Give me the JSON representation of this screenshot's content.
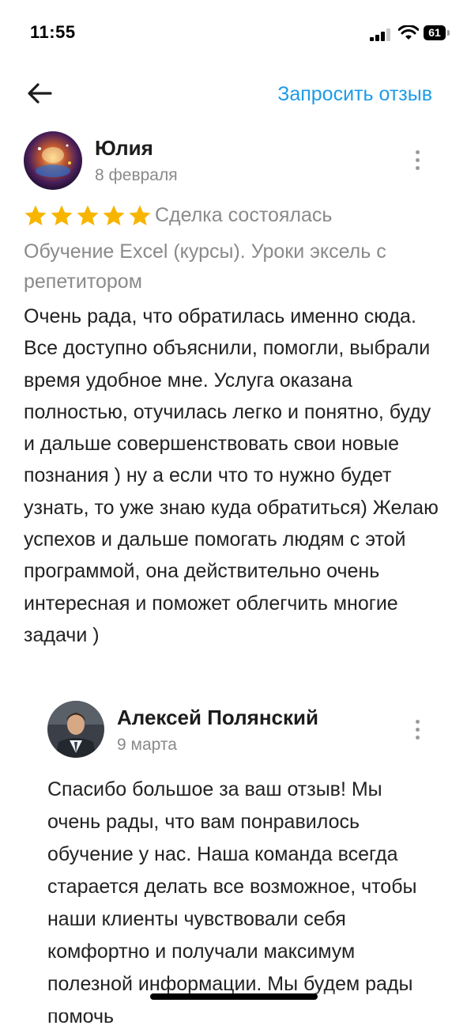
{
  "status_bar": {
    "time": "11:55",
    "battery": "61"
  },
  "header": {
    "request_review": "Запросить отзыв"
  },
  "review": {
    "author": "Юлия",
    "date": "8 февраля",
    "rating": 5,
    "rating_max": 5,
    "deal_status": "Сделка состоялась",
    "service": "Обучение Excel (курсы). Уроки эксель с репетитором",
    "text": "Очень рада, что обратилась именно сюда. Все доступно объяснили, помогли, выбрали время удобное мне. Услуга оказана полностью, отучилась легко и понятно, буду и дальше совершенствовать свои новые познания ) ну а если что то нужно будет узнать, то уже знаю куда обратиться) Желаю успехов и дальше помогать людям с этой программой, она действительно очень интересная и поможет облегчить многие задачи )"
  },
  "reply": {
    "author": "Алексей Полянский",
    "date": "9 марта",
    "text": "Спасибо большое за ваш отзыв! Мы очень рады, что вам понравилось обучение у нас. Наша команда всегда старается делать все возможное, чтобы наши клиенты чувствовали себя комфортно и получали максимум полезной информации. Мы будем рады помочь"
  },
  "colors": {
    "accent": "#1e9be6",
    "star": "#f7b500",
    "muted": "#8a8a8a"
  },
  "icons": [
    "back-arrow-icon",
    "more-options-icon",
    "star-icon",
    "signal-icon",
    "wifi-icon",
    "battery-icon"
  ]
}
